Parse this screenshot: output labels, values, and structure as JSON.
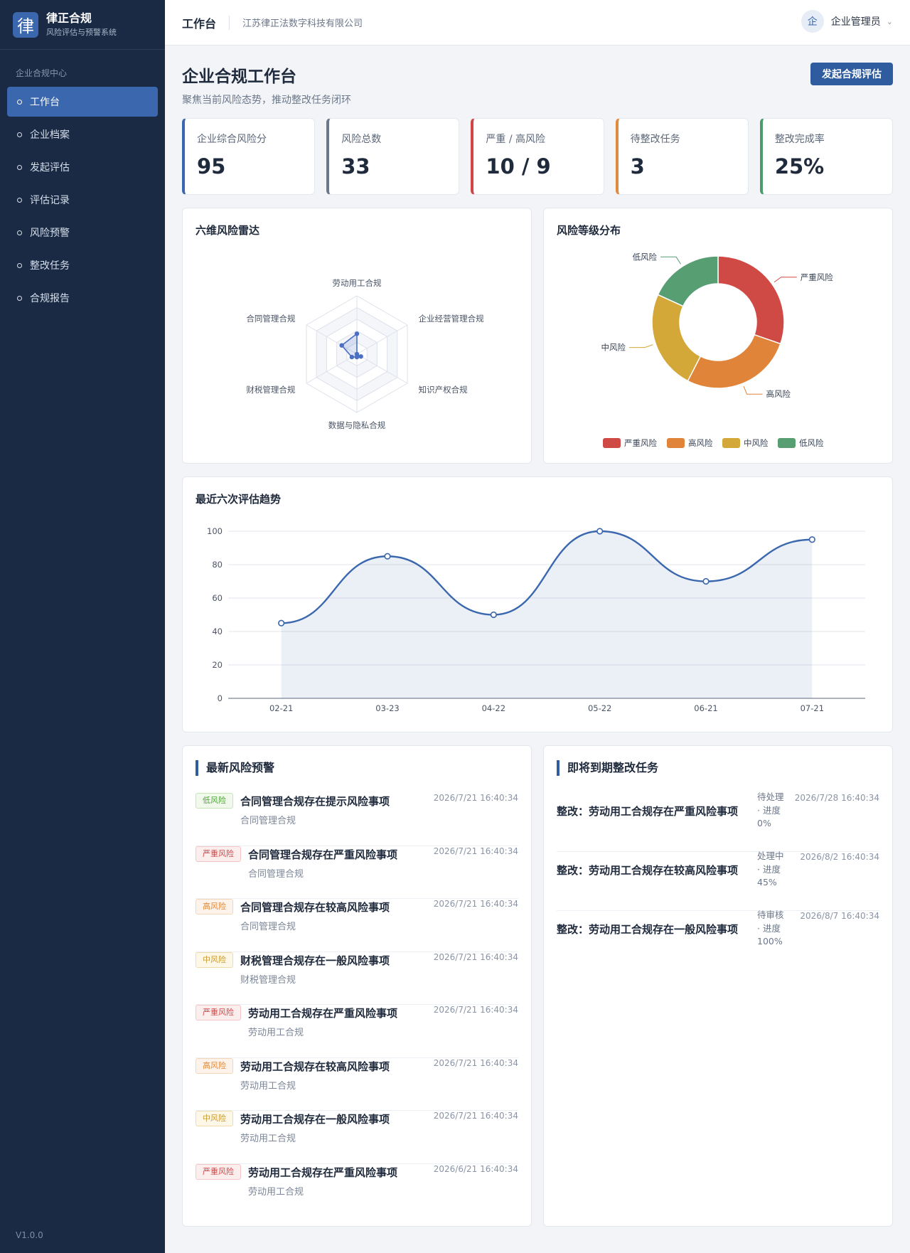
{
  "brand": {
    "logo_char": "律",
    "title": "律正合规",
    "subtitle": "风险评估与预警系统"
  },
  "sidebar": {
    "group_label": "企业合规中心",
    "items": [
      {
        "label": "工作台",
        "active": true
      },
      {
        "label": "企业档案"
      },
      {
        "label": "发起评估"
      },
      {
        "label": "评估记录"
      },
      {
        "label": "风险预警"
      },
      {
        "label": "整改任务"
      },
      {
        "label": "合规报告"
      }
    ],
    "version": "V1.0.0"
  },
  "header": {
    "title": "工作台",
    "company": "江苏律正法数字科技有限公司",
    "avatar_char": "企",
    "user": "企业管理员",
    "chevron": "⌄"
  },
  "page": {
    "title": "企业合规工作台",
    "subtitle": "聚焦当前风险态势，推动整改任务闭环",
    "action_button": "发起合规评估"
  },
  "kpis": [
    {
      "label": "企业综合风险分",
      "value": "95",
      "color": "#3a67ad"
    },
    {
      "label": "风险总数",
      "value": "33",
      "color": "#6b778a"
    },
    {
      "label": "严重 / 高风险",
      "value": "10 / 9",
      "color": "#d24545"
    },
    {
      "label": "待整改任务",
      "value": "3",
      "color": "#e08a3c"
    },
    {
      "label": "整改完成率",
      "value": "25%",
      "color": "#4e9a6b"
    }
  ],
  "radar": {
    "title": "六维风险雷达",
    "axes": [
      "劳动用工合规",
      "企业经营管理合规",
      "知识产权合规",
      "数据与隐私合规",
      "财税管理合规",
      "合同管理合规"
    ],
    "max": 100,
    "values": [
      35,
      0,
      8,
      5,
      10,
      30
    ],
    "color": "#4a6fc4"
  },
  "donut": {
    "title": "风险等级分布",
    "slices": [
      {
        "label": "严重风险",
        "value": 10,
        "color": "#cf4a45"
      },
      {
        "label": "高风险",
        "value": 9,
        "color": "#e0843a"
      },
      {
        "label": "中风险",
        "value": 8,
        "color": "#d4a838"
      },
      {
        "label": "低风险",
        "value": 6,
        "color": "#579e73"
      }
    ]
  },
  "chart_data": {
    "type": "line",
    "title": "最近六次评估趋势",
    "categories": [
      "02-21",
      "03-23",
      "04-22",
      "05-22",
      "06-21",
      "07-21"
    ],
    "values": [
      45,
      85,
      50,
      100,
      70,
      95
    ],
    "ylim": [
      0,
      100
    ],
    "yticks": [
      0,
      20,
      40,
      60,
      80,
      100
    ],
    "grid": true,
    "smooth": true,
    "area": true,
    "color": "#3a67ad"
  },
  "alerts": {
    "title": "最新风险预警",
    "items": [
      {
        "level": "低风险",
        "title": "合同管理合规存在提示风险事项",
        "category": "合同管理合规",
        "time": "2026/7/21 16:40:34"
      },
      {
        "level": "严重风险",
        "title": "合同管理合规存在严重风险事项",
        "category": "合同管理合规",
        "time": "2026/7/21 16:40:34"
      },
      {
        "level": "高风险",
        "title": "合同管理合规存在较高风险事项",
        "category": "合同管理合规",
        "time": "2026/7/21 16:40:34"
      },
      {
        "level": "中风险",
        "title": "财税管理合规存在一般风险事项",
        "category": "财税管理合规",
        "time": "2026/7/21 16:40:34"
      },
      {
        "level": "严重风险",
        "title": "劳动用工合规存在严重风险事项",
        "category": "劳动用工合规",
        "time": "2026/7/21 16:40:34"
      },
      {
        "level": "高风险",
        "title": "劳动用工合规存在较高风险事项",
        "category": "劳动用工合规",
        "time": "2026/7/21 16:40:34"
      },
      {
        "level": "中风险",
        "title": "劳动用工合规存在一般风险事项",
        "category": "劳动用工合规",
        "time": "2026/7/21 16:40:34"
      },
      {
        "level": "严重风险",
        "title": "劳动用工合规存在严重风险事项",
        "category": "劳动用工合规",
        "time": "2026/6/21 16:40:34"
      }
    ],
    "level_styles": {
      "低风险": {
        "color": "#52a33b",
        "bg": "#f0f9eb",
        "border": "#c6e6b5"
      },
      "严重风险": {
        "color": "#d24545",
        "bg": "#fdeeee",
        "border": "#f4c6c6"
      },
      "高风险": {
        "color": "#e08a3c",
        "bg": "#fdf3ea",
        "border": "#f4d6b8"
      },
      "中风险": {
        "color": "#c99a2e",
        "bg": "#fdf7e8",
        "border": "#efdcaa"
      }
    }
  },
  "tasks": {
    "title": "即将到期整改任务",
    "items": [
      {
        "title": "整改：劳动用工合规存在严重风险事项",
        "status": "待处理",
        "progress_text": "· 进度 0%",
        "time": "2026/7/28 16:40:34"
      },
      {
        "title": "整改：劳动用工合规存在较高风险事项",
        "status": "处理中",
        "progress_text": "· 进度 45%",
        "time": "2026/8/2 16:40:34"
      },
      {
        "title": "整改：劳动用工合规存在一般风险事项",
        "status": "待审核",
        "progress_text": "· 进度 100%",
        "time": "2026/8/7 16:40:34"
      }
    ]
  }
}
